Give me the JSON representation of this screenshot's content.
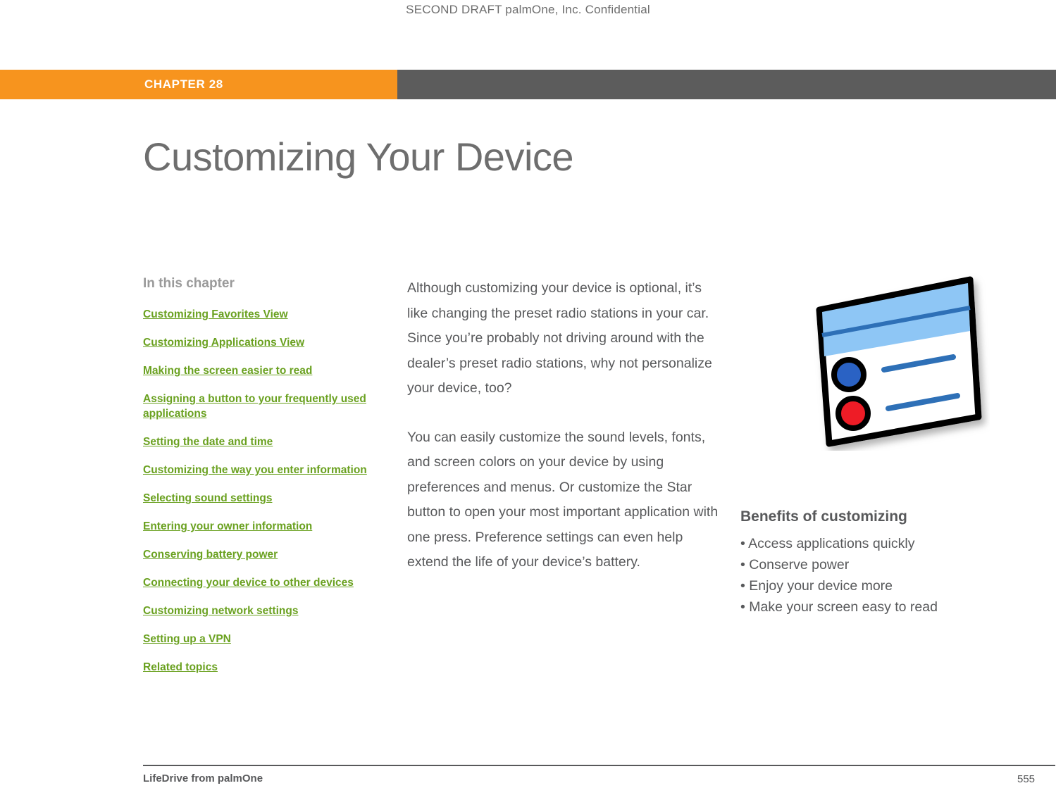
{
  "header": {
    "confidential_notice": "SECOND DRAFT palmOne, Inc.  Confidential"
  },
  "chapter": {
    "label": "CHAPTER 28",
    "title": "Customizing Your Device"
  },
  "toc": {
    "heading": "In this chapter",
    "items": [
      "Customizing Favorites View",
      "Customizing Applications View",
      "Making the screen easier to read",
      "Assigning a button to your frequently used applications",
      "Setting the date and time",
      "Customizing the way you enter information",
      "Selecting sound settings",
      "Entering your owner information",
      "Conserving battery power",
      "Connecting your device to other devices",
      "Customizing network settings",
      "Setting up a VPN",
      "Related topics"
    ]
  },
  "body": {
    "paragraphs": [
      "Although customizing your device is optional, it’s like changing the preset radio stations in your car. Since you’re probably not driving around with the dealer’s preset radio stations, why not personalize your device, too?",
      "You can easily customize the sound levels, fonts, and screen colors on your device by using preferences and menus. Or customize the Star button to open your most important application with one press. Preference settings can even help extend the life of your device’s battery."
    ]
  },
  "benefits": {
    "title": "Benefits of customizing",
    "items": [
      "• Access applications quickly",
      "• Conserve power",
      "• Enjoy your device more",
      "• Make your screen easy to read"
    ]
  },
  "illustration": {
    "name": "device-screen-illustration"
  },
  "footer": {
    "product": "LifeDrive from palmOne",
    "page_number": "555"
  },
  "colors": {
    "orange": "#f7941e",
    "gray_bar": "#5c5c5c",
    "link_green": "#6aa120",
    "body_gray": "#58595b",
    "title_gray": "#6e6e6e"
  }
}
